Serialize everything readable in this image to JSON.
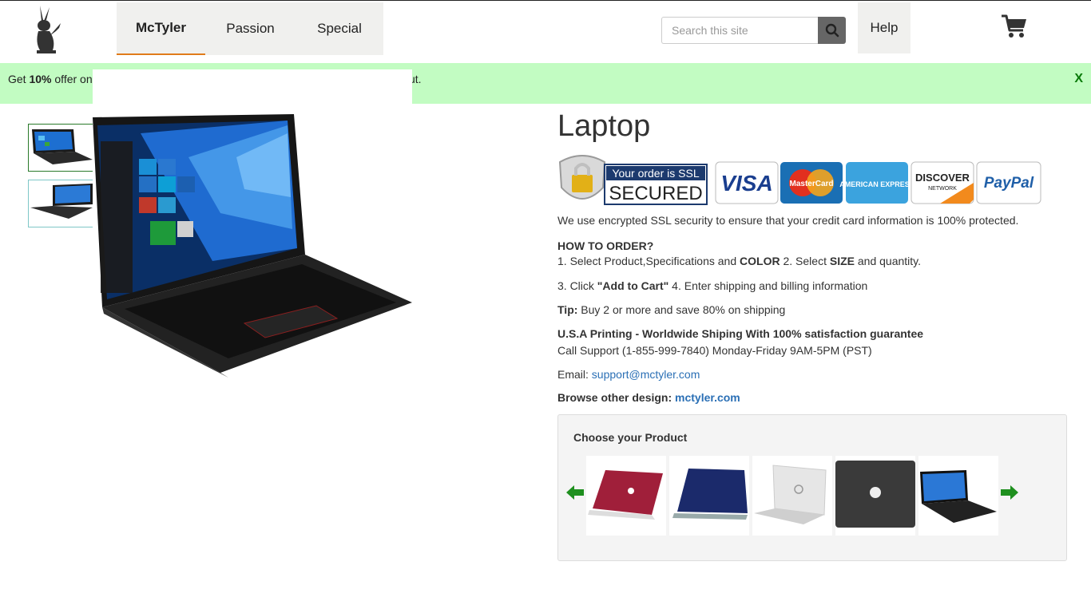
{
  "header": {
    "nav": [
      {
        "label": "McTyler",
        "active": true
      },
      {
        "label": "Passion",
        "active": false
      },
      {
        "label": "Special",
        "active": false
      }
    ],
    "search_placeholder": "Search this site",
    "help_label": "Help",
    "icons": {
      "logo": "rabbit-logo-icon",
      "search": "search-icon",
      "cart": "cart-icon"
    }
  },
  "banner": {
    "prefix": "Get ",
    "highlight": "10%",
    "text": " offer on",
    "tail": "ut.",
    "close_label": "X",
    "color": "#c2fcc2"
  },
  "product": {
    "title": "Laptop",
    "ssl_badge": {
      "line1": "Your order is SSL",
      "line2": "SECURED"
    },
    "payment_cards": [
      "VISA",
      "MasterCard",
      "AMERICAN EXPRESS",
      "DISCOVER",
      "NETWORK",
      "PayPal"
    ],
    "secure_text": "We use encrypted SSL security to ensure that your credit card information is 100% protected.",
    "how_to_order_heading": "HOW TO ORDER?",
    "step1_prefix": "1. Select Product,Specifications and ",
    "step1_bold": "COLOR",
    "step2_prefix": " 2. Select ",
    "step2_bold": "SIZE",
    "step2_suffix": " and quantity.",
    "step3_prefix": "3. Click ",
    "step3_bold": "\"Add to Cart\"",
    "step4": " 4. Enter shipping and billing information",
    "tip_label": "Tip:",
    "tip_text": " Buy 2 or more and save 80% on shipping",
    "guarantee": "U.S.A Printing - Worldwide Shiping With 100% satisfaction guarantee",
    "support": "Call Support (1-855-999-7840) Monday-Friday 9AM-5PM (PST)",
    "email_label": "Email: ",
    "email": "support@mctyler.com",
    "browse_label": "Browse other design: ",
    "browse_link": "mctyler.com"
  },
  "chooser": {
    "title": "Choose your Product",
    "items": [
      {
        "name": "red laptop"
      },
      {
        "name": "navy asus laptop"
      },
      {
        "name": "silver dell laptop"
      },
      {
        "name": "dark hp laptop"
      },
      {
        "name": "black lenovo laptop"
      }
    ],
    "arrow_color": "#1e8f1e"
  }
}
